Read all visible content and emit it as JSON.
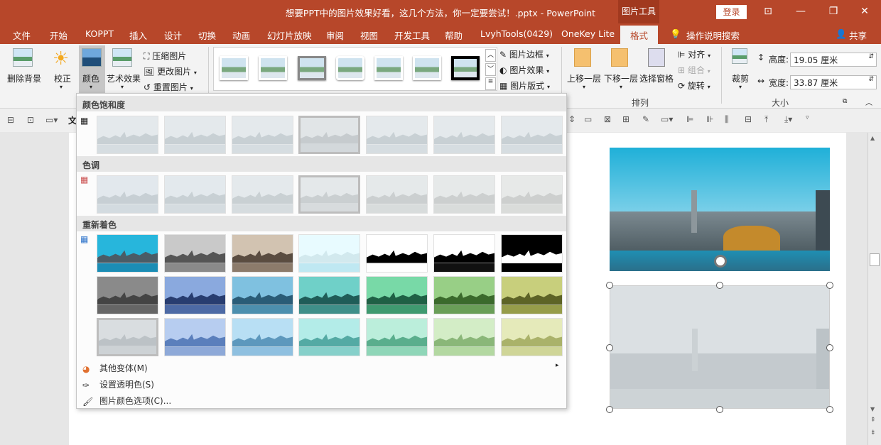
{
  "window": {
    "title": "想要PPT中的图片效果好看，这几个方法，你一定要尝试！.pptx - PowerPoint",
    "context_tool": "图片工具",
    "login": "登录",
    "share": "共享"
  },
  "tabs": [
    "文件",
    "开始",
    "KOPPT",
    "插入",
    "设计",
    "切换",
    "动画",
    "幻灯片放映",
    "审阅",
    "视图",
    "开发工具",
    "帮助",
    "LvyhTools(0429)",
    "OneKey Lite",
    "格式"
  ],
  "tell_me": "操作说明搜索",
  "ribbon": {
    "remove_bg": "删除背景",
    "corrections": "校正",
    "color": "颜色",
    "artistic": "艺术效果",
    "compress": "压缩图片",
    "change": "更改图片",
    "reset": "重置图片",
    "border": "图片边框",
    "effects": "图片效果",
    "layout": "图片版式",
    "bring_forward": "上移一层",
    "send_backward": "下移一层",
    "selection_pane": "选择窗格",
    "align": "对齐",
    "group": "组合",
    "rotate": "旋转",
    "arrange_label": "排列",
    "crop": "裁剪",
    "height_label": "高度:",
    "height_value": "19.05 厘米",
    "width_label": "宽度:",
    "width_value": "33.87 厘米",
    "size_label": "大小"
  },
  "dropdown": {
    "saturation": "颜色饱和度",
    "tone": "色调",
    "recolor": "重新着色",
    "more_variations": "其他变体(M)",
    "set_transparent": "设置透明色(S)",
    "color_options": "图片颜色选项(C)..."
  },
  "colors": {
    "brand": "#b7472a",
    "ribbon_bg": "#f3f3f3"
  }
}
